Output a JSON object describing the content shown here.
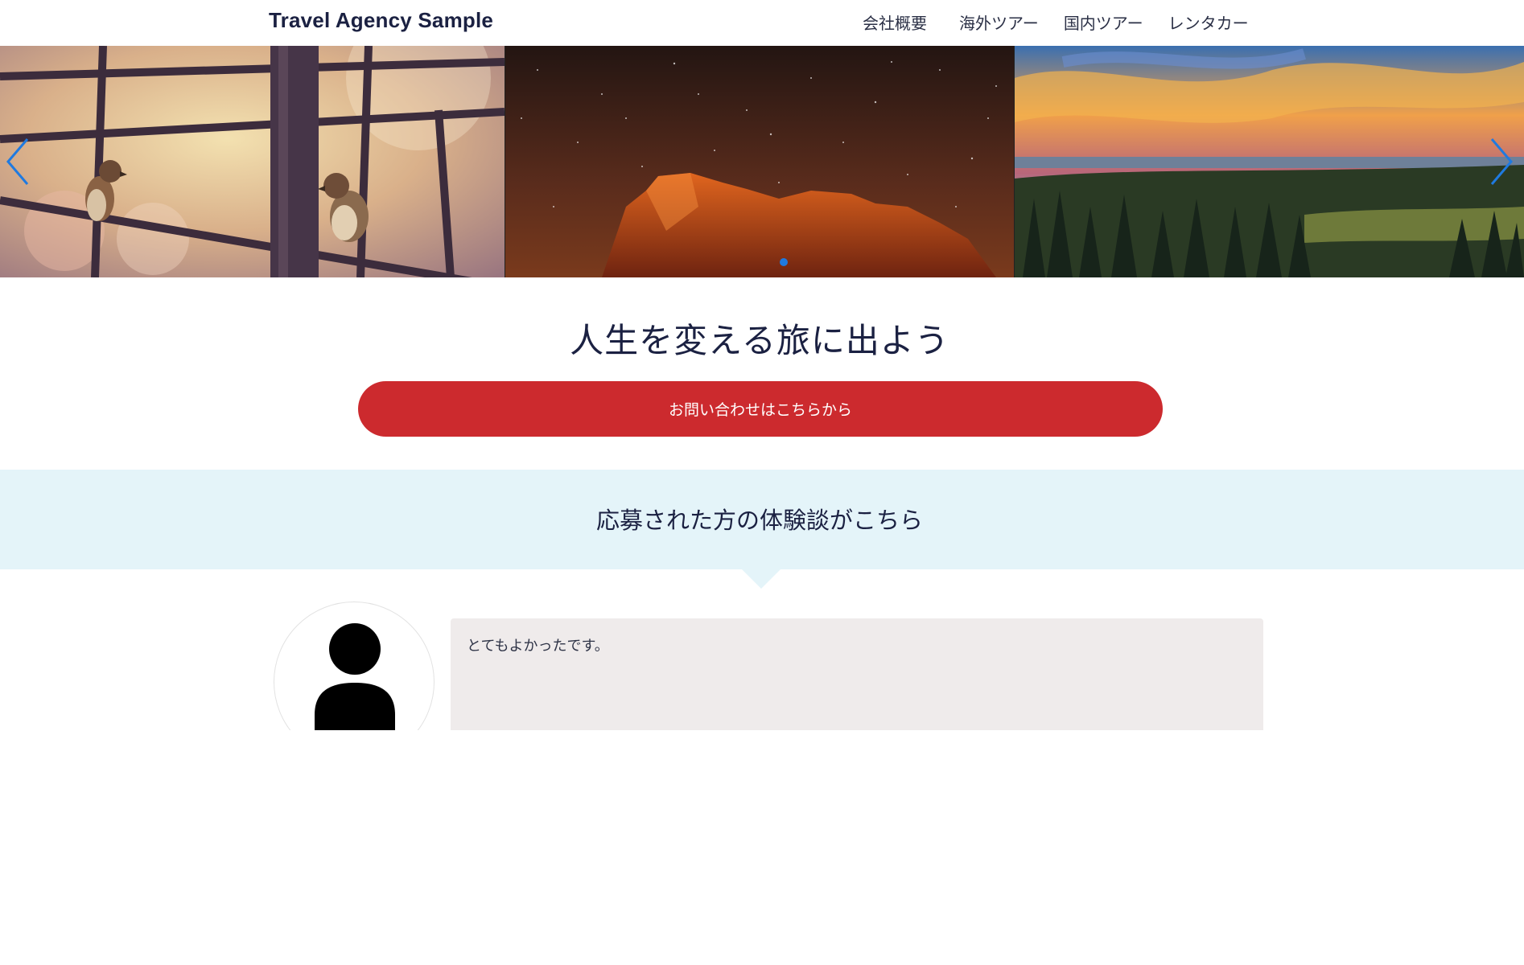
{
  "header": {
    "logo": "Travel Agency Sample",
    "nav": [
      {
        "label": "会社概要"
      },
      {
        "label": "海外ツアー"
      },
      {
        "label": "国内ツアー"
      },
      {
        "label": "レンタカー"
      }
    ]
  },
  "carousel": {
    "slides": [
      {
        "icon": "sparrows-on-fence-photo"
      },
      {
        "icon": "red-rock-night-sky-photo"
      },
      {
        "icon": "forest-sunset-photo"
      }
    ],
    "accent_color": "#1f7ae0"
  },
  "hero": {
    "title": "人生を変える旅に出よう",
    "cta_label": "お問い合わせはこちらから",
    "cta_color": "#cc2a2e"
  },
  "testimonials": {
    "heading": "応募された方の体験談がこちら",
    "band_color": "#e4f4f9",
    "items": [
      {
        "icon": "person-avatar-icon",
        "comment": "とてもよかったです。"
      }
    ]
  }
}
